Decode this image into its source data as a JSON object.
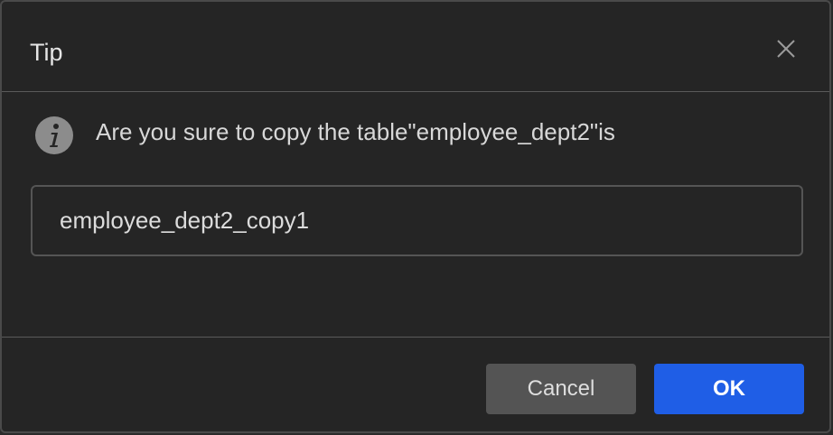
{
  "dialog": {
    "title": "Tip",
    "message": "Are you sure to copy the table\"employee_dept2\"is",
    "input_value": "employee_dept2_copy1",
    "cancel_label": "Cancel",
    "ok_label": "OK",
    "icons": {
      "close": "close-icon",
      "info": "info-icon"
    },
    "colors": {
      "background": "#252525",
      "ok_button": "#1f5ee6",
      "cancel_button": "#545454",
      "text": "#d8d8d8"
    }
  }
}
